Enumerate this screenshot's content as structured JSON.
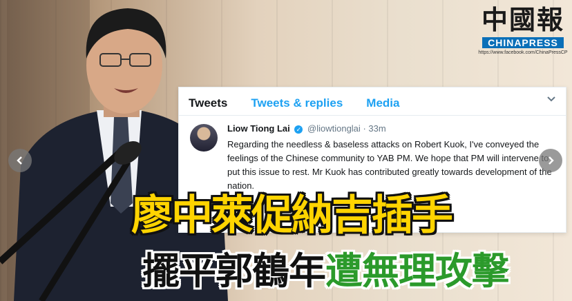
{
  "logo": {
    "chinese": "中國報",
    "english": "CHINAPRESS",
    "url": "https://www.facebook.com/ChinaPressCP"
  },
  "tweet_card": {
    "tabs": [
      {
        "label": "Tweets",
        "active": true
      },
      {
        "label": "Tweets & replies",
        "active": false
      },
      {
        "label": "Media",
        "active": false
      }
    ],
    "tweet": {
      "name": "Liow Tiong Lai",
      "handle": "@liowtionglai",
      "separator": "·",
      "time": "33m",
      "text": "Regarding the needless & baseless attacks on Robert Kuok, I've conveyed the feelings of the Chinese community to YAB PM. We hope that PM will intervene to put this issue to rest. Mr Kuok has contributed greatly towards development of the nation."
    }
  },
  "headline": {
    "line1": "廖中萊促納吉插手",
    "line2_part1": "擺平郭鶴年",
    "line2_part2": "遭無理攻擊"
  },
  "colors": {
    "headline1": "#ffd400",
    "headline2_black": "#111111",
    "headline2_green": "#2b9a2b",
    "twitter_blue": "#1da1f2"
  },
  "icons": [
    "verified-icon",
    "chevron-down-icon",
    "arrow-left-icon",
    "arrow-right-icon"
  ]
}
